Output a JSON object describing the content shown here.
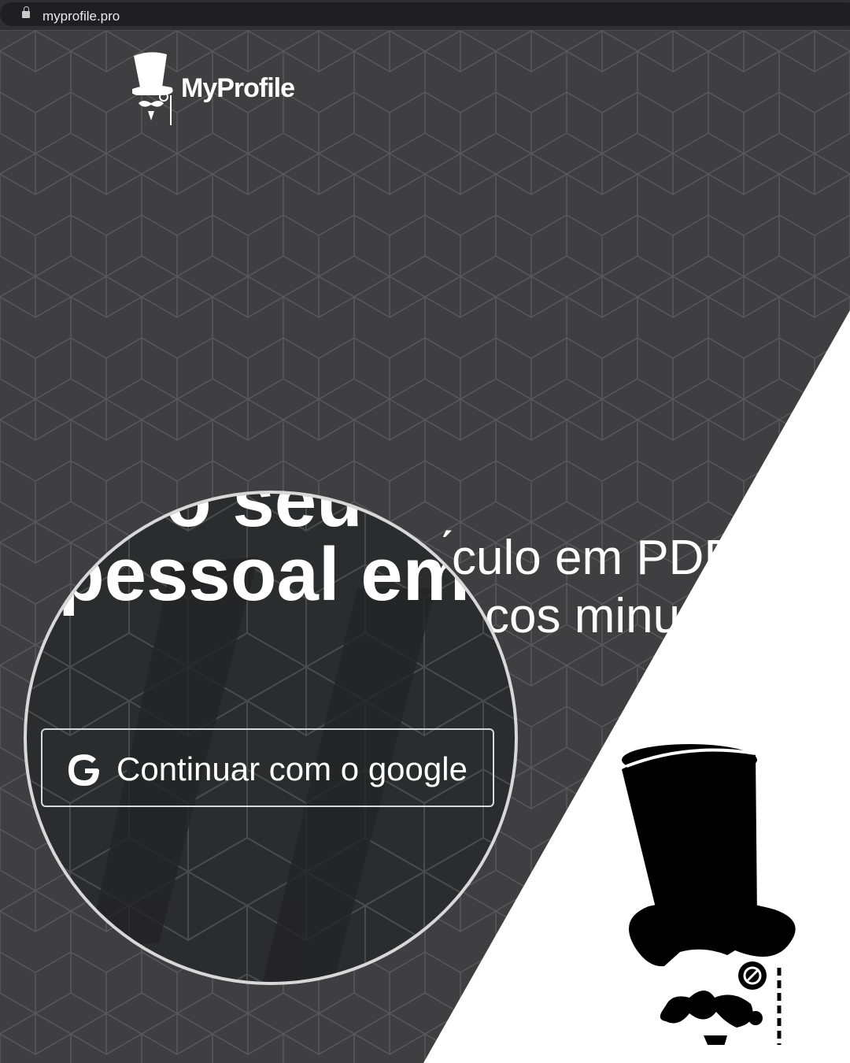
{
  "browser": {
    "url": "myprofile.pro"
  },
  "brand": {
    "name": "MyProfile"
  },
  "hero": {
    "line1_fragment": "́culo em PDF",
    "line2_fragment": "cos minu",
    "magnified_top": "o seu c",
    "magnified_line": "pessoal em p"
  },
  "auth": {
    "google_button_label": "Continuar com o google"
  },
  "icons": {
    "lock": "lock-icon",
    "google": "google-g-icon",
    "logo": "top-hat-mustache-logo",
    "mascot": "top-hat-monocle-mascot"
  },
  "colors": {
    "background": "#3f3f41",
    "pattern_line": "#58585a",
    "magnifier_bg": "#2b2c2e",
    "white": "#ffffff"
  }
}
